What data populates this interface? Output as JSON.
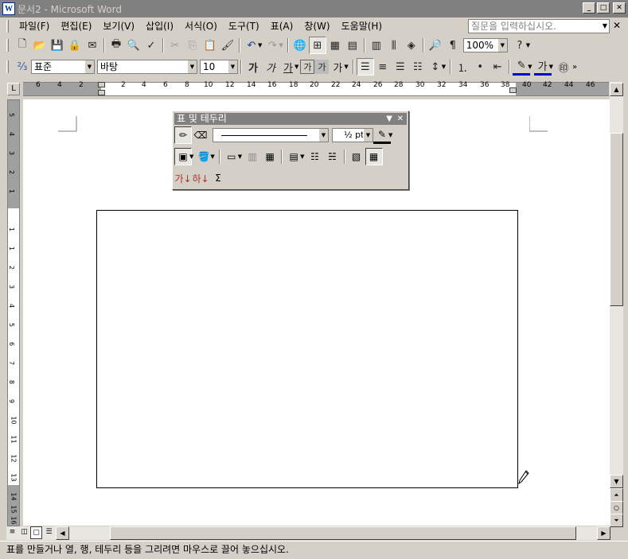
{
  "window": {
    "title": "문서2 - Microsoft Word",
    "icon_label": "W"
  },
  "menubar": {
    "items": [
      {
        "label": "파일(F)"
      },
      {
        "label": "편집(E)"
      },
      {
        "label": "보기(V)"
      },
      {
        "label": "삽입(I)"
      },
      {
        "label": "서식(O)"
      },
      {
        "label": "도구(T)"
      },
      {
        "label": "표(A)"
      },
      {
        "label": "창(W)"
      },
      {
        "label": "도움말(H)"
      }
    ],
    "help_placeholder": "질문을 입력하십시오."
  },
  "standard_toolbar": {
    "zoom": "100%"
  },
  "formatting_toolbar": {
    "style": "표준",
    "font": "바탕",
    "size": "10"
  },
  "ruler": {
    "labels": [
      "6",
      "4",
      "2",
      "2",
      "4",
      "6",
      "8",
      "10",
      "12",
      "14",
      "16",
      "18",
      "20",
      "22",
      "24",
      "26",
      "28",
      "30",
      "32",
      "34",
      "36",
      "38",
      "40",
      "42",
      "44",
      "46"
    ],
    "corner_label": "L"
  },
  "vertical_ruler": {
    "labels": [
      "5",
      "4",
      "3",
      "2",
      "1",
      "1",
      "1",
      "2",
      "3",
      "4",
      "5",
      "6",
      "7",
      "8",
      "9",
      "10",
      "11",
      "12",
      "13",
      "14",
      "15",
      "16"
    ]
  },
  "tables_borders_toolbar": {
    "title": "표 및 테두리",
    "line_weight": "½ pt",
    "sum_label": "Σ"
  },
  "statusbar": {
    "text": "표를 만들거나 열, 행, 테두리 등을 그리려면 마우스로 끌어 놓으십시오."
  },
  "colors": {
    "inactive_title": "#808080",
    "face": "#d4d0c8",
    "page": "#ffffff"
  }
}
